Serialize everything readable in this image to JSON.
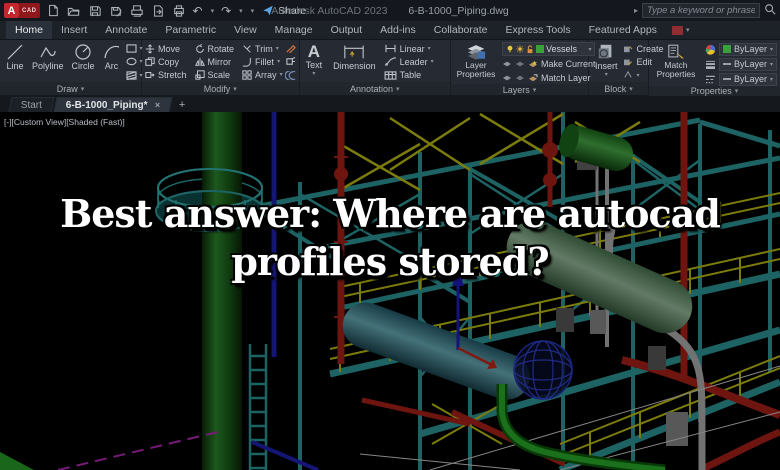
{
  "titlebar": {
    "logo": "A",
    "logo_sub": "CAD",
    "share_label": "Share",
    "app_name": "Autodesk AutoCAD 2023",
    "doc_name": "6-B-1000_Piping.dwg",
    "search_placeholder": "Type a keyword or phrase"
  },
  "ribbon": {
    "tabs": [
      {
        "label": "Home",
        "active": true
      },
      {
        "label": "Insert"
      },
      {
        "label": "Annotate"
      },
      {
        "label": "Parametric"
      },
      {
        "label": "View"
      },
      {
        "label": "Manage"
      },
      {
        "label": "Output"
      },
      {
        "label": "Add-ins"
      },
      {
        "label": "Collaborate"
      },
      {
        "label": "Express Tools"
      },
      {
        "label": "Featured Apps"
      }
    ],
    "draw": {
      "line": "Line",
      "polyline": "Polyline",
      "circle": "Circle",
      "arc": "Arc",
      "footer": "Draw"
    },
    "modify": {
      "move": "Move",
      "rotate": "Rotate",
      "trim": "Trim",
      "copy": "Copy",
      "mirror": "Mirror",
      "fillet": "Fillet",
      "stretch": "Stretch",
      "scale": "Scale",
      "array": "Array",
      "footer": "Modify"
    },
    "annotation": {
      "text": "Text",
      "dimension": "Dimension",
      "linear": "Linear",
      "leader": "Leader",
      "table": "Table",
      "footer": "Annotation"
    },
    "layers": {
      "layer_properties": "Layer Properties",
      "current_layer": "Vessels",
      "make_current": "Make Current",
      "match_layer": "Match Layer",
      "footer": "Layers"
    },
    "block": {
      "insert": "Insert",
      "create": "Create",
      "edit": "Edit",
      "footer": "Block"
    },
    "properties": {
      "match_properties": "Match Properties",
      "color_value": "ByLayer",
      "lineweight_value": "ByLayer",
      "linetype_value": "ByLayer",
      "footer": "Properties"
    }
  },
  "file_tabs": {
    "start": "Start",
    "document": "6-B-1000_Piping*"
  },
  "viewport": {
    "controls_label": "[-][Custom View][Shaded (Fast)]"
  },
  "caption": {
    "line1": "Best answer: Where are autocad",
    "line2": "profiles stored?"
  },
  "colors": {
    "layer_swatch": "#3aa03a",
    "logo_red": "#c1272d",
    "structure_teal": "#2fa0a0",
    "beam_yellow": "#c8c816",
    "pipe_red": "#b3221a",
    "column_green": "#2f8f2f",
    "caption_text": "#ffffff"
  }
}
